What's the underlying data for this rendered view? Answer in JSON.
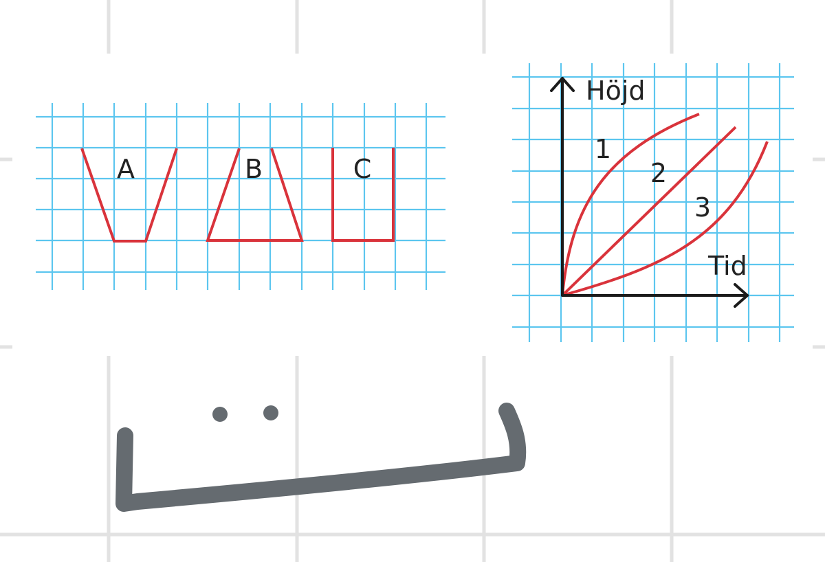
{
  "shapes": {
    "a_label": "A",
    "b_label": "B",
    "c_label": "C",
    "line_color": "#d9333b",
    "grid_color": "#5cc6ef"
  },
  "graph": {
    "y_axis_label": "Höjd",
    "x_axis_label": "Tid",
    "curve_labels": [
      "1",
      "2",
      "3"
    ],
    "curve_color": "#d9333b"
  },
  "annotation": {
    "ink_color": "#656b70",
    "description_free": true
  }
}
